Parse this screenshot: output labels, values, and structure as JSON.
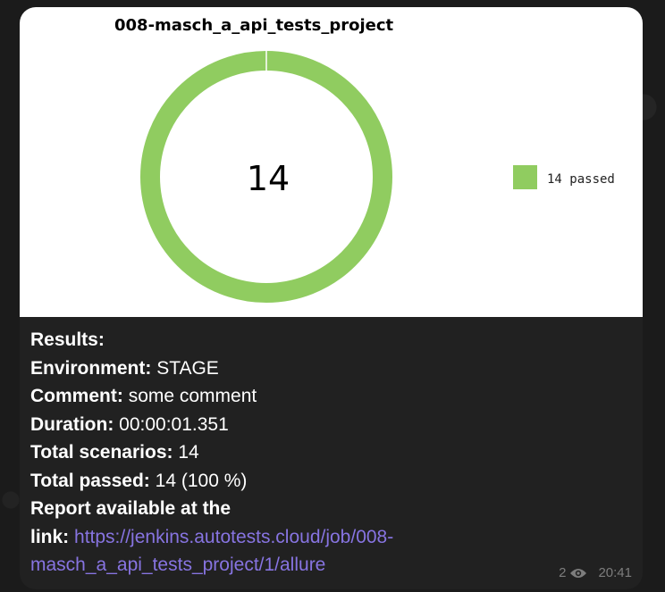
{
  "chart_data": {
    "type": "pie",
    "title": "008-masch_a_api_tests_project",
    "center_label": "14",
    "categories": [
      "passed"
    ],
    "values": [
      14
    ],
    "legend": [
      {
        "label": "14 passed",
        "color": "#90cc60"
      }
    ],
    "legend_position": "right",
    "donut": true
  },
  "caption": {
    "results_label": "Results:",
    "environment_label": "Environment:",
    "environment_value": "STAGE",
    "comment_label": "Comment:",
    "comment_value": "some comment",
    "duration_label": "Duration:",
    "duration_value": "00:00:01.351",
    "total_scenarios_label": "Total scenarios:",
    "total_scenarios_value": "14",
    "total_passed_label": "Total passed:",
    "total_passed_value": "14 (100 %)",
    "report_label_line1": "Report available at the",
    "report_label_line2": "link:",
    "report_link_part1": "https://jenkins.autotests.cloud/job/008-",
    "report_link_part2": "masch_a_api_tests_project/1/allure"
  },
  "meta": {
    "views": "2",
    "time": "20:41",
    "icon": "eye-icon"
  },
  "colors": {
    "passed": "#90cc60",
    "link": "#8774e1",
    "bubble": "#212121"
  }
}
